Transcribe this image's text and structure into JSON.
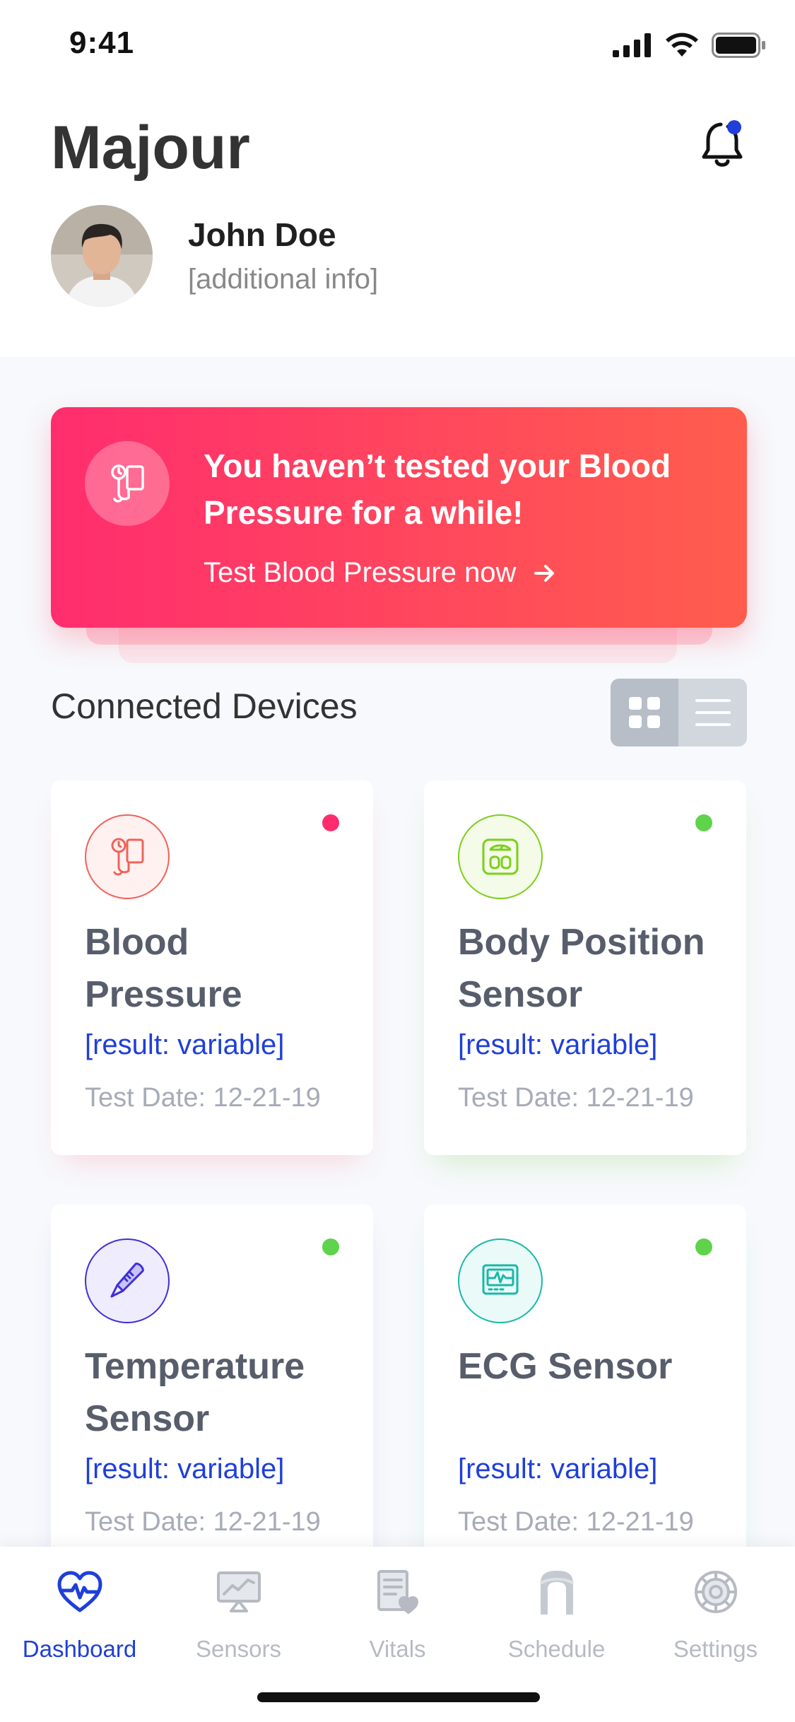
{
  "status_bar": {
    "time": "9:41"
  },
  "header": {
    "app_title": "Majour",
    "user_name": "John Doe",
    "user_info": "[additional info]"
  },
  "banner": {
    "title": "You haven’t tested your Blood Pressure for a while!",
    "link_label": "Test Blood Pressure now",
    "icon": "blood-pressure-icon"
  },
  "devices_section": {
    "title": "Connected Devices",
    "view_mode": "grid"
  },
  "devices": [
    {
      "name": "Blood Pressure",
      "result": "[result: variable]",
      "test_date": "Test Date: 12-21-19",
      "status_color": "#ff2d6e",
      "icon": "blood-pressure-icon",
      "accent": "#f0625a"
    },
    {
      "name": "Body Position Sensor",
      "result": "[result: variable]",
      "test_date": "Test Date: 12-21-19",
      "status_color": "#5fd34b",
      "icon": "scale-icon",
      "accent": "#7ccf1b"
    },
    {
      "name": "Temperature Sensor",
      "result": "[result: variable]",
      "test_date": "Test Date: 12-21-19",
      "status_color": "#5fd34b",
      "icon": "thermometer-icon",
      "accent": "#3f2fd6"
    },
    {
      "name": "ECG Sensor",
      "result": "[result: variable]",
      "test_date": "Test Date: 12-21-19",
      "status_color": "#5fd34b",
      "icon": "ecg-monitor-icon",
      "accent": "#19b8a8"
    }
  ],
  "tabs": [
    {
      "label": "Dashboard",
      "icon": "heartbeat-icon",
      "active": true
    },
    {
      "label": "Sensors",
      "icon": "monitor-chart-icon",
      "active": false
    },
    {
      "label": "Vitals",
      "icon": "document-heart-icon",
      "active": false
    },
    {
      "label": "Schedule",
      "icon": "calendar-icon",
      "active": false
    },
    {
      "label": "Settings",
      "icon": "gear-icon",
      "active": false
    }
  ],
  "colors": {
    "brand_blue": "#1f3fd8",
    "banner_start": "#ff2d6e",
    "banner_end": "#ff5d4d",
    "inactive": "#b6bac3"
  }
}
